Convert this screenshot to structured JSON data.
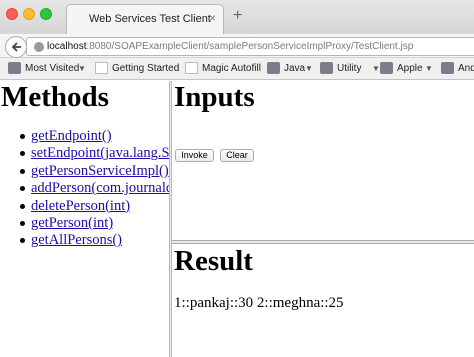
{
  "browser": {
    "tab_title": "Web Services Test Client",
    "tab_close": "×",
    "new_tab": "+",
    "url_host": "localhost",
    "url_rest": ":8080/SOAPExampleClient/samplePersonServiceImplProxy/TestClient.jsp",
    "bookmarks": [
      {
        "label": "Most Visited",
        "icon": "folder-icon",
        "caret": true
      },
      {
        "label": "Getting Started",
        "icon": "page-icon",
        "caret": false
      },
      {
        "label": "Magic Autofill",
        "icon": "page-icon",
        "caret": false
      },
      {
        "label": "Java",
        "icon": "folder-icon",
        "caret": true
      },
      {
        "label": "Utility",
        "icon": "folder-icon",
        "caret": true
      },
      {
        "label": "Apple",
        "icon": "folder-icon",
        "caret": true
      },
      {
        "label": "Andr",
        "icon": "folder-icon",
        "caret": false
      }
    ]
  },
  "methods": {
    "heading": "Methods",
    "items": [
      "getEndpoint()",
      "setEndpoint(java.lang.String)",
      "getPersonServiceImpl()",
      "addPerson(com.journaldev.jaxws.beans.Person)",
      "deletePerson(int)",
      "getPerson(int)",
      "getAllPersons()"
    ]
  },
  "inputs": {
    "heading": "Inputs",
    "invoke_label": "Invoke",
    "clear_label": "Clear"
  },
  "result": {
    "heading": "Result",
    "output": "1::pankaj::30 2::meghna::25"
  },
  "colors": {
    "link": "#1a0dab",
    "close_button": "#fc5f57",
    "minimize_button": "#fdbc2e",
    "maximize_button": "#28c840"
  }
}
